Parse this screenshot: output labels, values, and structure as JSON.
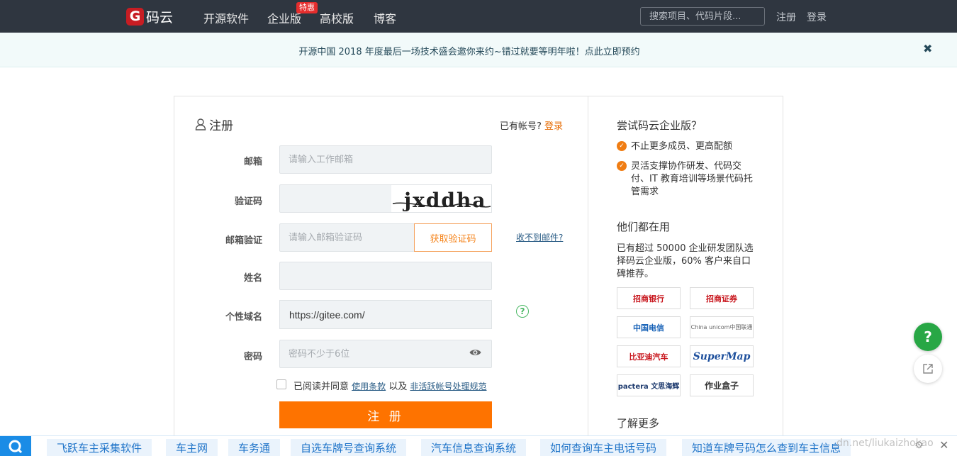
{
  "nav": {
    "logo_mark": "G",
    "logo_text": "码云",
    "items": [
      "开源软件",
      "企业版",
      "高校版",
      "博客"
    ],
    "badge": "特惠",
    "search_placeholder": "搜索项目、代码片段...",
    "register": "注册",
    "login": "登录"
  },
  "notice": {
    "text": "开源中国 2018 年度最后一场技术盛会邀你来约~错过就要等明年啦！点此立即预约",
    "close": "✖"
  },
  "form": {
    "title": "注册",
    "have_account": "已有帐号?",
    "login_link": "登录",
    "email_label": "邮箱",
    "email_placeholder": "请输入工作邮箱",
    "captcha_label": "验证码",
    "captcha_text": "jxddha",
    "email_verify_label": "邮箱验证",
    "email_verify_placeholder": "请输入邮箱验证码",
    "get_code": "获取验证码",
    "no_mail": "收不到邮件?",
    "name_label": "姓名",
    "domain_label": "个性域名",
    "domain_prefix": "https://gitee.com/",
    "password_label": "密码",
    "password_placeholder": "密码不少于6位",
    "agree_prefix": "已阅读并同意",
    "terms": "使用条款",
    "and": "以及",
    "rules": "非活跃帐号处理规范",
    "submit": "注 册"
  },
  "side": {
    "try_title": "尝试码云企业版？",
    "bullet1": "不止更多成员、更高配额",
    "bullet2": "灵活支撑协作研发、代码交付、IT 教育培训等场景代码托管需求",
    "users_title": "他们都在用",
    "users_text": "已有超过 50000 企业研发团队选择码云企业版，60% 客户来自口碑推荐。",
    "logos": [
      "招商银行",
      "招商证券",
      "中国电信",
      "China unicom中国联通",
      "比亚迪汽车",
      "SuperMap",
      "pactera 文思海辉",
      "作业盒子"
    ],
    "more": "了解更多"
  },
  "adbar": {
    "items": [
      "飞跃车主采集软件",
      "车主网",
      "车务通",
      "自选车牌号查询系统",
      "汽车信息查询系统",
      "如何查询车主电话号码",
      "知道车牌号码怎么查到车主信息"
    ],
    "watermark": "dn.net/liukaizhokao"
  },
  "float": {
    "help": "?"
  }
}
